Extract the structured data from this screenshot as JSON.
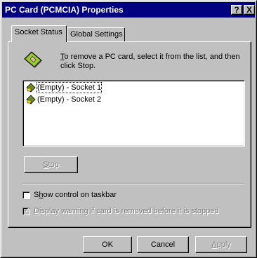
{
  "window": {
    "title": "PC Card (PCMCIA) Properties",
    "help_glyph": "?",
    "close_glyph": "X"
  },
  "tabs": [
    {
      "label": "Socket Status",
      "active": true
    },
    {
      "label": "Global Settings",
      "active": false
    }
  ],
  "instruction": {
    "mnemonic": "T",
    "text_rest": "o remove a PC card, select it from the list, and then click Stop.",
    "icon": "pc-card-icon"
  },
  "sockets": [
    {
      "label": "(Empty) - Socket 1",
      "selected": true,
      "icon": "socket-icon"
    },
    {
      "label": "(Empty) - Socket 2",
      "selected": false,
      "icon": "socket-icon"
    }
  ],
  "stop_button": {
    "mnemonic": "S",
    "rest": "top",
    "enabled": false
  },
  "options": {
    "show_control": {
      "before": "S",
      "mnemonic": "h",
      "after": "ow control on taskbar",
      "checked": false,
      "enabled": true
    },
    "display_warning": {
      "mnemonic": "D",
      "after": "isplay warning if card is removed before it is stopped",
      "checked": true,
      "enabled": false
    }
  },
  "buttons": {
    "ok": "OK",
    "cancel": "Cancel",
    "apply_mnemonic": "A",
    "apply_rest": "pply"
  }
}
